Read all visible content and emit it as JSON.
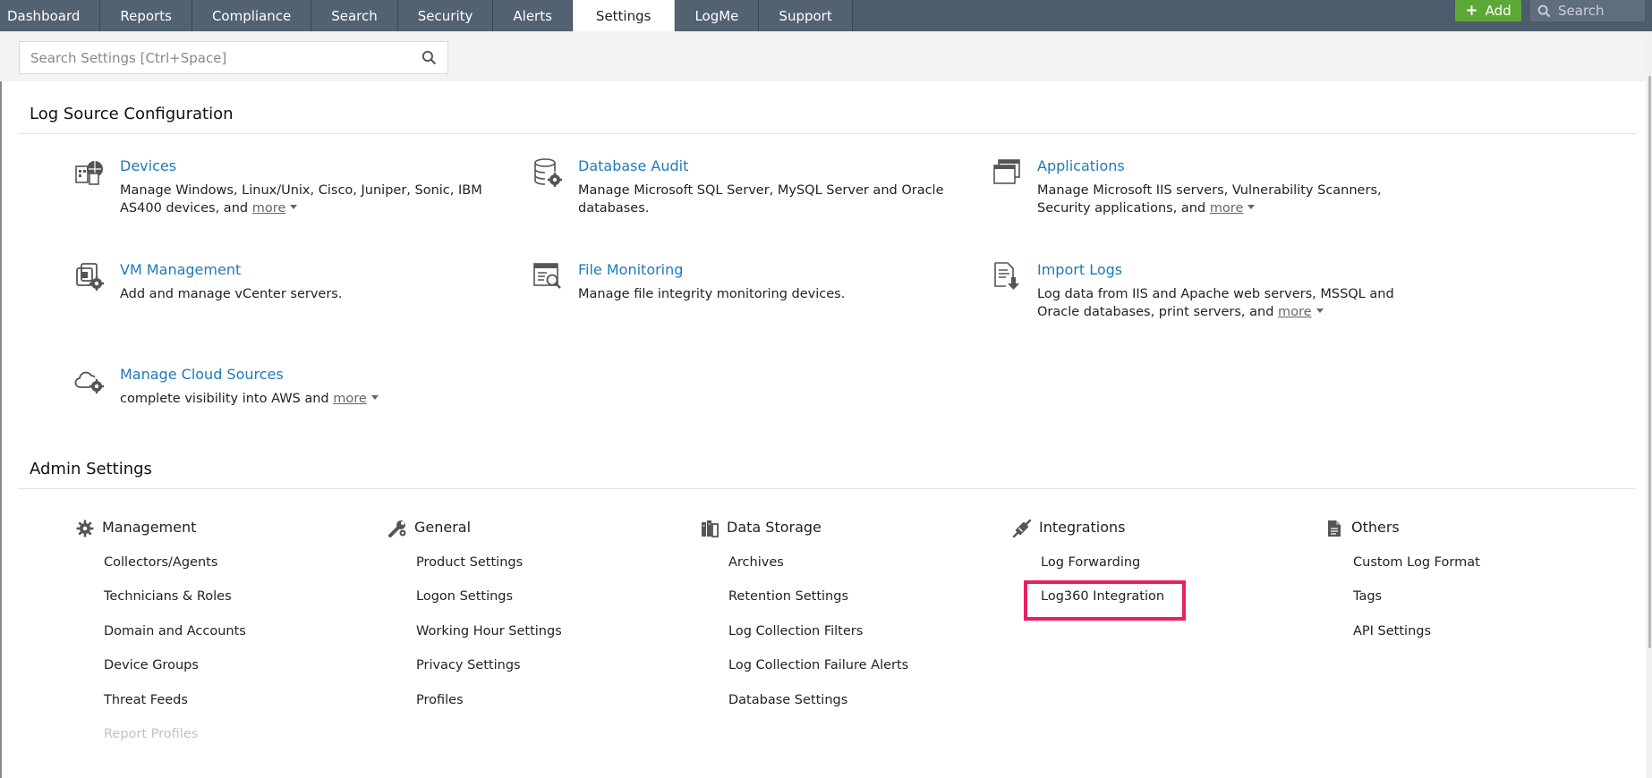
{
  "nav": {
    "tabs": [
      "Dashboard",
      "Reports",
      "Compliance",
      "Search",
      "Security",
      "Alerts",
      "Settings",
      "LogMe",
      "Support"
    ],
    "active_tab": "Settings",
    "add_label": "Add",
    "search_placeholder": "Search"
  },
  "settings_search": {
    "placeholder": "Search Settings [Ctrl+Space]"
  },
  "log_source": {
    "title": "Log Source Configuration",
    "items": [
      {
        "icon": "devices-icon",
        "title": "Devices",
        "desc": "Manage Windows, Linux/Unix, Cisco, Juniper, Sonic, IBM AS400 devices, and",
        "more": "more"
      },
      {
        "icon": "database-audit-icon",
        "title": "Database Audit",
        "desc": "Manage Microsoft SQL Server, MySQL Server and Oracle databases.",
        "more": ""
      },
      {
        "icon": "applications-icon",
        "title": "Applications",
        "desc": "Manage Microsoft IIS servers, Vulnerability Scanners, Security applications, and",
        "more": "more"
      },
      {
        "icon": "vm-management-icon",
        "title": "VM Management",
        "desc": "Add and manage vCenter servers.",
        "more": ""
      },
      {
        "icon": "file-monitoring-icon",
        "title": "File Monitoring",
        "desc": "Manage file integrity monitoring devices.",
        "more": ""
      },
      {
        "icon": "import-logs-icon",
        "title": "Import Logs",
        "desc": "Log data from IIS and Apache web servers, MSSQL and Oracle databases, print servers, and",
        "more": "more"
      },
      {
        "icon": "cloud-sources-icon",
        "title": "Manage Cloud Sources",
        "desc": "complete visibility into AWS and",
        "more": "more"
      }
    ]
  },
  "admin": {
    "title": "Admin Settings",
    "columns": [
      {
        "icon": "gear-icon",
        "title": "Management",
        "links": [
          "Collectors/Agents",
          "Technicians & Roles",
          "Domain and Accounts",
          "Device Groups",
          "Threat Feeds",
          "Report Profiles"
        ]
      },
      {
        "icon": "wrench-icon",
        "title": "General",
        "links": [
          "Product Settings",
          "Logon Settings",
          "Working Hour Settings",
          "Privacy Settings",
          "Profiles"
        ]
      },
      {
        "icon": "data-storage-icon",
        "title": "Data Storage",
        "links": [
          "Archives",
          "Retention Settings",
          "Log Collection Filters",
          "Log Collection Failure Alerts",
          "Database Settings"
        ]
      },
      {
        "icon": "integrations-icon",
        "title": "Integrations",
        "links": [
          "Log Forwarding",
          "Log360 Integration"
        ]
      },
      {
        "icon": "document-icon",
        "title": "Others",
        "links": [
          "Custom Log Format",
          "Tags",
          "API Settings"
        ]
      }
    ],
    "disabled_link": "Report Profiles",
    "highlighted_link": "Log360 Integration"
  },
  "colors": {
    "nav_bg": "#4c5c6b",
    "link_blue": "#1e7ab8",
    "add_green": "#5ba836",
    "highlight_pink": "#ea1e63"
  }
}
